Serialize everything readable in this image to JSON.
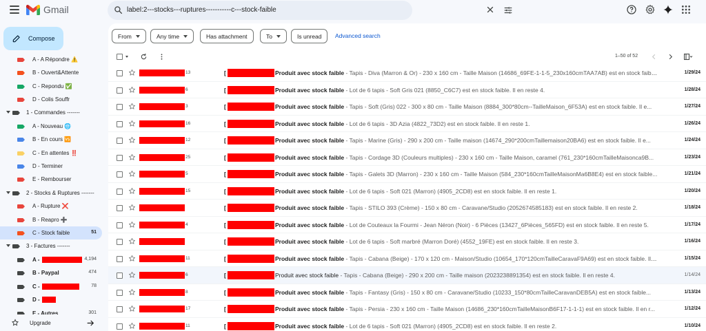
{
  "app": {
    "name": "Gmail"
  },
  "colors": {
    "accent_blue": "#0b57d0",
    "compose_bg": "#c2e7ff",
    "active_bg": "#d3e3fd",
    "redaction": "#ff0000",
    "search_bg": "#e9eef6"
  },
  "search": {
    "query": "label:2---stocks---ruptures-----------c---stock-faible"
  },
  "header_icons": [
    "help-icon",
    "settings-icon",
    "gemini-icon",
    "apps-icon"
  ],
  "compose": {
    "label": "Compose"
  },
  "sidebar": {
    "items": [
      {
        "label": "A - A Répondre ⚠️",
        "color": "#e8453c"
      },
      {
        "label": "B - Ouvert&Attente",
        "color": "#f4511e"
      },
      {
        "label": "C - Repondu ✅",
        "color": "#16a765"
      },
      {
        "label": "D - Colis Souffr",
        "color": "#e8453c"
      },
      {
        "label": "1 - Commandes -------",
        "color": "#444746"
      },
      {
        "label": "A - Nouveau 🌐",
        "color": "#16a765"
      },
      {
        "label": "B - En cours 🆚",
        "color": "#4a86e8"
      },
      {
        "label": "C - En attentes ‼️",
        "color": "#fad165"
      },
      {
        "label": "D - Terminer",
        "color": "#4a86e8"
      },
      {
        "label": "E - Rembourser",
        "color": "#e8453c"
      },
      {
        "label": "2 - Stocks & Ruptures -------",
        "color": "#444746"
      },
      {
        "label": "A - Rupture ❌",
        "color": "#e8453c"
      },
      {
        "label": "B - Reapro ➕",
        "color": "#e8453c"
      },
      {
        "label": "C - Stock faible",
        "count": "51",
        "color": "#f4511e"
      },
      {
        "label": "3 - Factures -------",
        "color": "#444746"
      },
      {
        "label": "A -",
        "count": "4,194",
        "color": "#444746"
      },
      {
        "label": "B - Paypal",
        "count": "474",
        "color": "#444746"
      },
      {
        "label": "C -",
        "count": "78",
        "color": "#444746"
      },
      {
        "label": "D -",
        "color": "#444746"
      },
      {
        "label": "E - Autres",
        "count": "301",
        "color": "#444746"
      }
    ],
    "upgrade": "Upgrade"
  },
  "filters": {
    "from": "From",
    "any_time": "Any time",
    "has_attachment": "Has attachment",
    "to": "To",
    "is_unread": "Is unread",
    "advanced": "Advanced search"
  },
  "pager": {
    "range": "1–50 of 52"
  },
  "emails": [
    {
      "num": "13",
      "subject": "Produit avec stock faible",
      "snippet": " - Tapis - Diva (Marron & Or) - 230 x 160 cm - Taille Maison (14686_69FE-1-1-5_230x160cmTAA7AB) est en stock faible...",
      "date": "1/29/24",
      "read": false
    },
    {
      "num": "6",
      "subject": "Produit avec stock faible",
      "snippet": " - Lot de 6 tapis - Soft Gris 021 (8850_C6C7) est en stock faible. Il en reste 4.",
      "date": "1/28/24",
      "read": false
    },
    {
      "num": "3",
      "subject": "Produit avec stock faible",
      "snippet": " - Tapis - Soft (Gris) 022 - 300 x 80 cm - Taille Maison (8884_300*80cm--TailleMaison_6F53A) est en stock faible. Il e...",
      "date": "1/27/24",
      "read": false
    },
    {
      "num": "16",
      "subject": "Produit avec stock faible",
      "snippet": " - Lot de 6 tapis - 3D Azia (4822_73D2) est en stock faible. Il en reste 1.",
      "date": "1/26/24",
      "read": false
    },
    {
      "num": "12",
      "subject": "Produit avec stock faible",
      "snippet": " - Tapis - Marine (Gris) - 290 x 200 cm - Taille maison (14674_290*200cmTaillemaison20BA6) est en stock faible. Il e...",
      "date": "1/24/24",
      "read": false
    },
    {
      "num": "25",
      "subject": "Produit avec stock faible",
      "snippet": " - Tapis - Cordage 3D (Couleurs multiples) - 230 x 160 cm - Taille Maison, caramel (761_230*160cmTailleMaisonca9B...",
      "date": "1/23/24",
      "read": false
    },
    {
      "num": "5",
      "subject": "Produit avec stock faible",
      "snippet": " - Tapis - Galets 3D (Marron) - 230 x 160 cm - Taille Maison (584_230*160cmTailleMaisonMa6B8E4) est en stock faible...",
      "date": "1/21/24",
      "read": false
    },
    {
      "num": "15",
      "subject": "Produit avec stock faible",
      "snippet": " - Lot de 6 tapis - Soft 021 (Marron) (4905_2CD8) est en stock faible. Il en reste 1.",
      "date": "1/20/24",
      "read": false
    },
    {
      "num": "",
      "subject": "Produit avec stock faible",
      "snippet": " - Tapis - STILO 393 (Crème) - 150 x 80 cm - Caravane/Studio (2052674585183) est en stock faible. Il en reste 2.",
      "date": "1/18/24",
      "read": false
    },
    {
      "num": "4",
      "subject": "Produit avec stock faible",
      "snippet": " - Lot de Couteaux la Fourmi - Jean Néron (Noir) - 6 Pièces (13427_6Pièces_565FD) est en stock faible. Il en reste 5.",
      "date": "1/17/24",
      "read": false
    },
    {
      "num": "",
      "subject": "Produit avec stock faible",
      "snippet": " - Lot de 6 tapis - Soft marbré (Marron Doré) (4552_19FE) est en stock faible. Il en reste 3.",
      "date": "1/16/24",
      "read": false
    },
    {
      "num": "11",
      "subject": "Produit avec stock faible",
      "snippet": " - Tapis - Cabana (Beige) - 170 x 120 cm - Maison/Studio (10654_170*120cmTailleCaravaF9A69) est en stock faible. Il e...",
      "date": "1/15/24",
      "read": false
    },
    {
      "num": "6",
      "subject": "Produit avec stock faible",
      "snippet": " - Tapis - Cabana (Beige) - 290 x 200 cm - Taille maison (2023238891354) est en stock faible. Il en reste 4.",
      "date": "1/14/24",
      "read": true
    },
    {
      "num": "8",
      "subject": "Produit avec stock faible",
      "snippet": " - Tapis - Fantasy (Gris) - 150 x 80 cm - Caravane/Studio (10233_150*80cmTailleCaravanDEB5A) est en stock faible...",
      "date": "1/13/24",
      "read": false
    },
    {
      "num": "17",
      "subject": "Produit avec stock faible",
      "snippet": " - Tapis - Persia - 230 x 160 cm - Taille Maison (14686_230*160cmTailleMaisonB6F17-1-1-1) est en stock faible. Il en r...",
      "date": "1/12/24",
      "read": false
    },
    {
      "num": "11",
      "subject": "Produit avec stock faible",
      "snippet": " - Lot de 6 tapis - Soft 021 (Marron) (4905_2CD8) est en stock faible. Il en reste 2.",
      "date": "1/10/24",
      "read": false
    }
  ]
}
